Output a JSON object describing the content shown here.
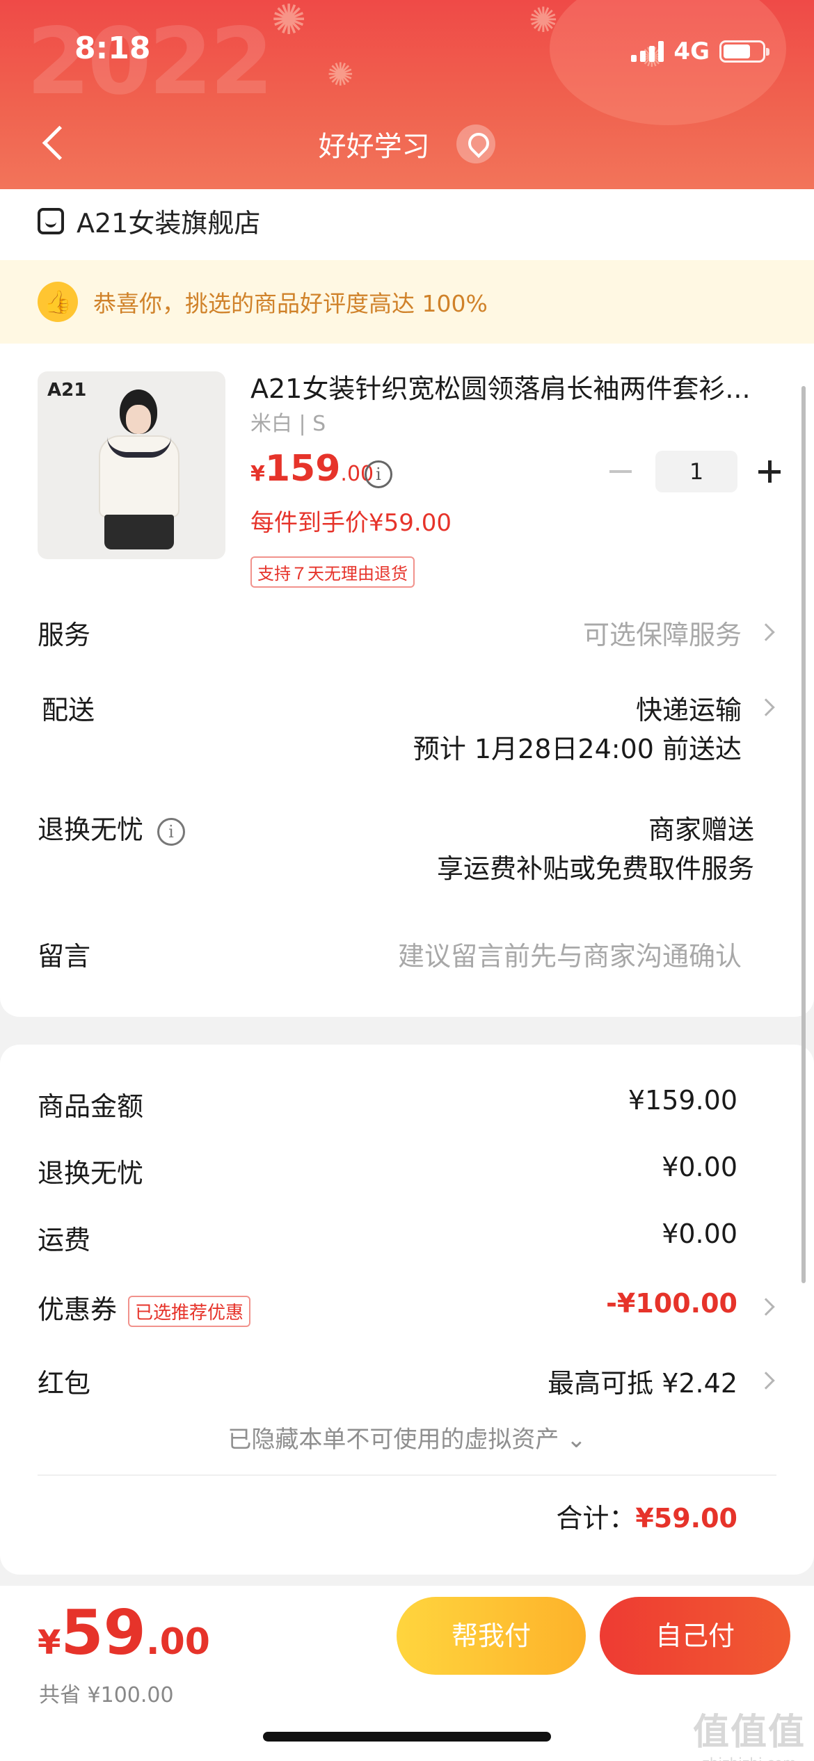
{
  "status_bar": {
    "time": "8:18",
    "network": "4G"
  },
  "header": {
    "title": "好好学习",
    "decor_year": "2022"
  },
  "shop": {
    "name": "A21女装旗舰店"
  },
  "banner": {
    "text": "恭喜你，挑选的商品好评度高达 100%"
  },
  "product": {
    "brand_on_image": "A21",
    "title": "A21女装针织宽松圆领落肩长袖两件套衫...",
    "spec": "米白 | S",
    "price_currency": "¥",
    "price_int": "159",
    "price_dec": ".00",
    "final_price": "每件到手价¥59.00",
    "return_tag": "支持７天无理由退货",
    "quantity": "1"
  },
  "service": {
    "label": "服务",
    "value": "可选保障服务"
  },
  "delivery": {
    "label": "配送",
    "method": "快递运输",
    "eta": "预计 1月28日24:00 前送达"
  },
  "return_worry": {
    "label": "退换无忧",
    "value1": "商家赠送",
    "value2": "享运费补贴或免费取件服务"
  },
  "message": {
    "label": "留言",
    "placeholder": "建议留言前先与商家沟通确认"
  },
  "summary": {
    "goods_label": "商品金额",
    "goods_value": "¥159.00",
    "return_label": "退换无忧",
    "return_value": "¥0.00",
    "shipping_label": "运费",
    "shipping_value": "¥0.00",
    "coupon_label": "优惠券",
    "coupon_tag": "已选推荐优惠",
    "coupon_value": "-¥100.00",
    "redpack_label": "红包",
    "redpack_value": "最高可抵 ¥2.42",
    "hidden_assets": "已隐藏本单不可使用的虚拟资产 ⌄",
    "total_label": "合计：",
    "total_value": "¥59.00"
  },
  "bottom": {
    "currency": "¥",
    "amount_int": "59",
    "amount_dec": ".00",
    "saved": "共省 ¥100.00",
    "help_pay": "帮我付",
    "self_pay": "自己付"
  },
  "watermark": {
    "logo": "值值值",
    "url": "zhizhizhi.com"
  },
  "colors": {
    "accent": "#e6332a",
    "header": "#ef4a47",
    "help_btn": "#fdb22a",
    "banner_bg": "#fff8e3"
  }
}
